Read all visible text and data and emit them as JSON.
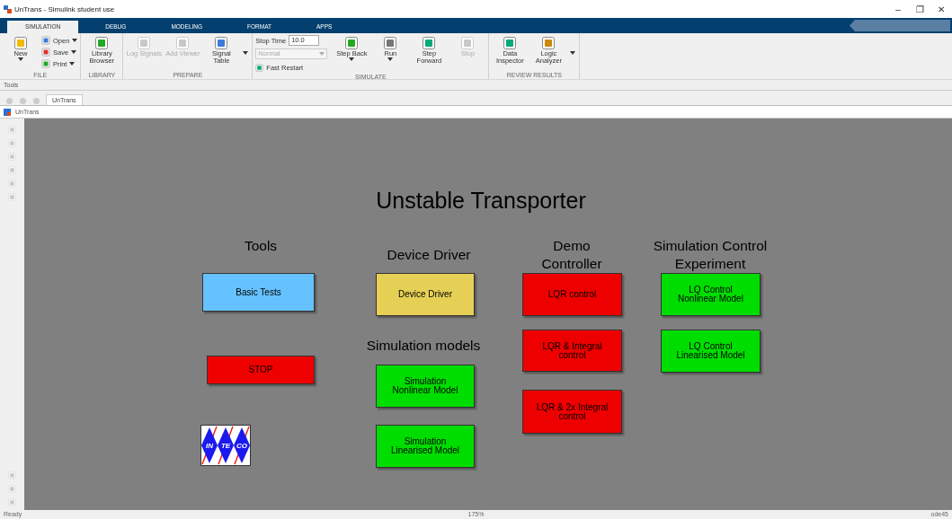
{
  "window": {
    "title": "UnTrans - Simulink student use",
    "controls": [
      "–",
      "❐",
      "✕"
    ]
  },
  "tabs": [
    {
      "label": "SIMULATION",
      "selected": true
    },
    {
      "label": "DEBUG",
      "selected": false
    },
    {
      "label": "MODELING",
      "selected": false
    },
    {
      "label": "FORMAT",
      "selected": false
    },
    {
      "label": "APPS",
      "selected": false
    }
  ],
  "toolstrip": [
    {
      "label": "FILE",
      "items": [
        {
          "kind": "large",
          "label": "New",
          "caret": true,
          "disabled": false
        },
        {
          "kind": "small",
          "label": "Open",
          "caret": true,
          "disabled": false
        },
        {
          "kind": "small",
          "label": "Save",
          "caret": true,
          "disabled": false
        },
        {
          "kind": "small",
          "label": "Print",
          "caret": true,
          "disabled": false
        }
      ]
    },
    {
      "label": "LIBRARY",
      "items": [
        {
          "kind": "large",
          "label": "Library Browser",
          "caret": false,
          "disabled": false
        }
      ]
    },
    {
      "label": "PREPARE",
      "items": [
        {
          "kind": "large",
          "label": "Log Signals",
          "caret": false,
          "disabled": true
        },
        {
          "kind": "large",
          "label": "Add Viewer",
          "caret": false,
          "disabled": true
        },
        {
          "kind": "large",
          "label": "Signal Table",
          "caret": false,
          "disabled": false
        },
        {
          "kind": "more"
        }
      ]
    },
    {
      "label": "SIMULATE",
      "items": [
        {
          "kind": "stoptime",
          "label": "Stop Time",
          "value": "10.0",
          "mode": "Normal",
          "restart": "Fast Restart"
        },
        {
          "kind": "large",
          "label": "Step Back",
          "caret": true,
          "disabled": false
        },
        {
          "kind": "large",
          "label": "Run",
          "caret": true,
          "disabled": false
        },
        {
          "kind": "large",
          "label": "Step Forward",
          "caret": false,
          "disabled": false
        },
        {
          "kind": "large",
          "label": "Stop",
          "caret": false,
          "disabled": true
        }
      ]
    },
    {
      "label": "REVIEW RESULTS",
      "items": [
        {
          "kind": "large",
          "label": "Data Inspector",
          "caret": false,
          "disabled": false
        },
        {
          "kind": "large",
          "label": "Logic Analyzer",
          "caret": false,
          "disabled": false
        },
        {
          "kind": "more"
        }
      ]
    }
  ],
  "tools_bar": "Tools",
  "explorer_tab": "UnTrans",
  "address": "UnTrans",
  "diagram": {
    "title": "Unstable Transporter",
    "headings": [
      "Tools",
      "Device Driver",
      "Demo\nController",
      "Simulation Control\nExperiment",
      "Simulation models"
    ],
    "blocks": [
      {
        "label": "Basic Tests",
        "color": "#66c2ff"
      },
      {
        "label": "Device Driver",
        "color": "#e6cf55"
      },
      {
        "label": "LQR control",
        "color": "#ee0000"
      },
      {
        "label": "LQ Control Nonlinear Model",
        "color": "#00dd00"
      },
      {
        "label": "LQR & Integral control",
        "color": "#ee0000"
      },
      {
        "label": "LQ Control Linearised Model",
        "color": "#00dd00"
      },
      {
        "label": "STOP",
        "color": "#ee0000"
      },
      {
        "label": "Simulation Nonlinear Model",
        "color": "#00dd00"
      },
      {
        "label": "LQR & 2x Integral control",
        "color": "#ee0000"
      },
      {
        "label": "Simulation Linearised Model",
        "color": "#00dd00"
      }
    ],
    "logo": {
      "letters": [
        "IN",
        "TE",
        "CO"
      ]
    }
  },
  "status_bar": {
    "state": "Ready",
    "zoom": "175%",
    "solver": "ode45"
  }
}
